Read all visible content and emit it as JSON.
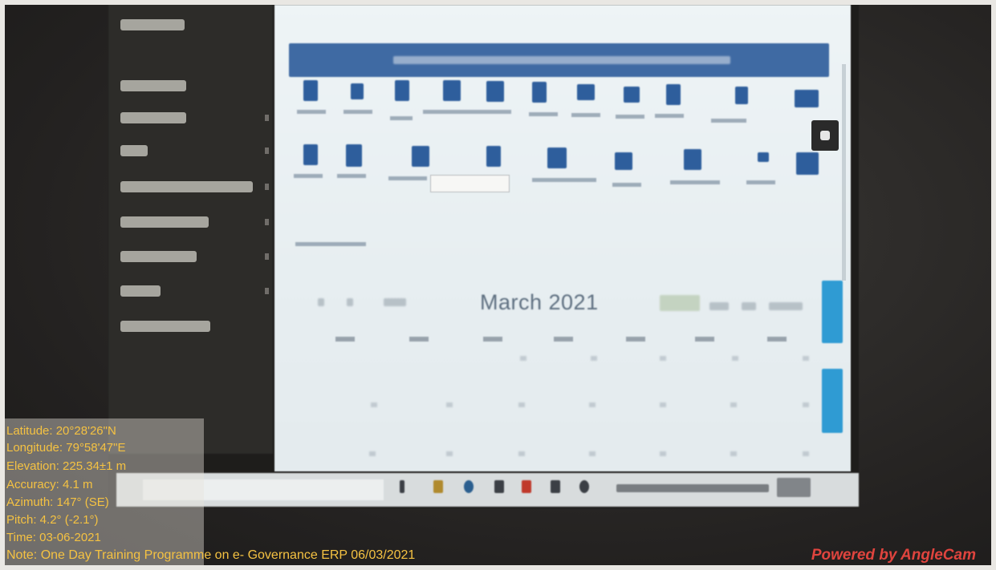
{
  "calendar": {
    "month_title": "March 2021"
  },
  "overlay": {
    "latitude": "Latitude: 20°28'26\"N",
    "longitude": "Longitude: 79°58'47\"E",
    "elevation": "Elevation: 225.34±1 m",
    "accuracy": "Accuracy: 4.1 m",
    "azimuth": "Azimuth: 147° (SE)",
    "pitch": "Pitch: 4.2° (-2.1°)",
    "time": "Time: 03-06-2021",
    "note": "Note: One Day Training Programme on e- Governance ERP 06/03/2021"
  },
  "watermark": "Powered by AngleCam",
  "colors": {
    "overlay_text": "#f5c242",
    "watermark_text": "#e0443e",
    "banner_blue": "#3f6aa3",
    "side_tab_blue": "#2f9bd3"
  }
}
